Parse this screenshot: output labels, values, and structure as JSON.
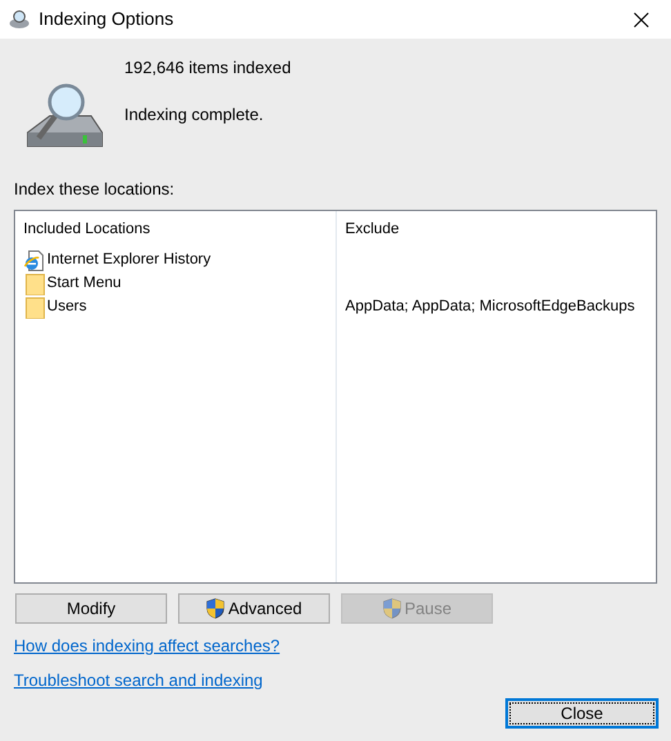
{
  "window": {
    "title": "Indexing Options"
  },
  "status": {
    "count": "192,646 items indexed",
    "message": "Indexing complete."
  },
  "locations_label": "Index these locations:",
  "table": {
    "columns": [
      "Included Locations",
      "Exclude"
    ],
    "rows": [
      {
        "kind": "web",
        "location": "Internet Explorer History",
        "exclude": ""
      },
      {
        "kind": "folder",
        "location": "Start Menu",
        "exclude": ""
      },
      {
        "kind": "folder",
        "location": "Users",
        "exclude": "AppData; AppData; MicrosoftEdgeBackups"
      }
    ]
  },
  "buttons": [
    {
      "label": "Modify",
      "shield": false,
      "disabled": false
    },
    {
      "label": "Advanced",
      "shield": true,
      "disabled": false
    },
    {
      "label": "Pause",
      "shield": true,
      "disabled": true
    }
  ],
  "links": [
    "How does indexing affect searches?",
    "Troubleshoot search and indexing"
  ],
  "close_button": {
    "label": "Close",
    "focused": true
  }
}
